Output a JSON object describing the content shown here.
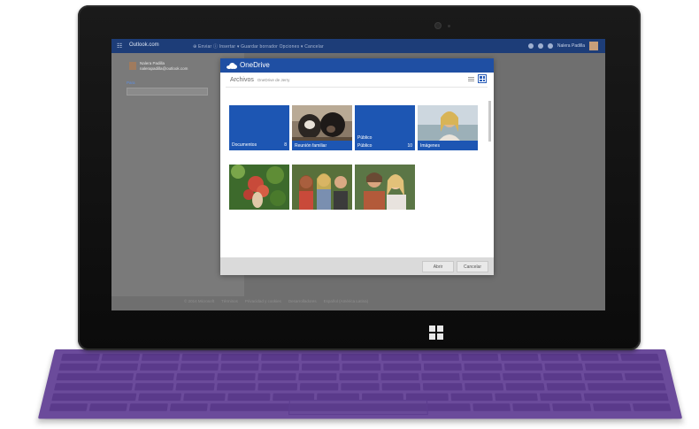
{
  "outlook": {
    "brand": "Outlook.com",
    "actions": "⊕ Enviar  ⓘ Insertar ▾  Guardar borrador  Opciones ▾  Cancelar",
    "user_name": "Nalera Padilla",
    "sender_name": "Nalera Padilla",
    "sender_email": "nalerapadilla@outlook.com",
    "to_label": "Para",
    "footer": [
      "© 2014 Microsoft",
      "Términos",
      "Privacidad y cookies",
      "Desarrolladores",
      "Español (América Latina)"
    ]
  },
  "picker": {
    "title": "OneDrive",
    "breadcrumb_root": "Archivos",
    "breadcrumb_sub": "OneDrive de Jerry",
    "tiles": [
      {
        "label": "Documentos",
        "count": "8"
      },
      {
        "label": "Reunión familiar",
        "count": ""
      },
      {
        "label": "Público",
        "sublabel": "Público",
        "count": "10"
      },
      {
        "label": "Imágenes",
        "count": ""
      }
    ],
    "open_label": "Abrir",
    "cancel_label": "Cancelar"
  },
  "colors": {
    "onedrive_blue": "#1f4fa3",
    "folder_blue": "#1d56b3",
    "keyboard_purple": "#6b4b9b"
  }
}
